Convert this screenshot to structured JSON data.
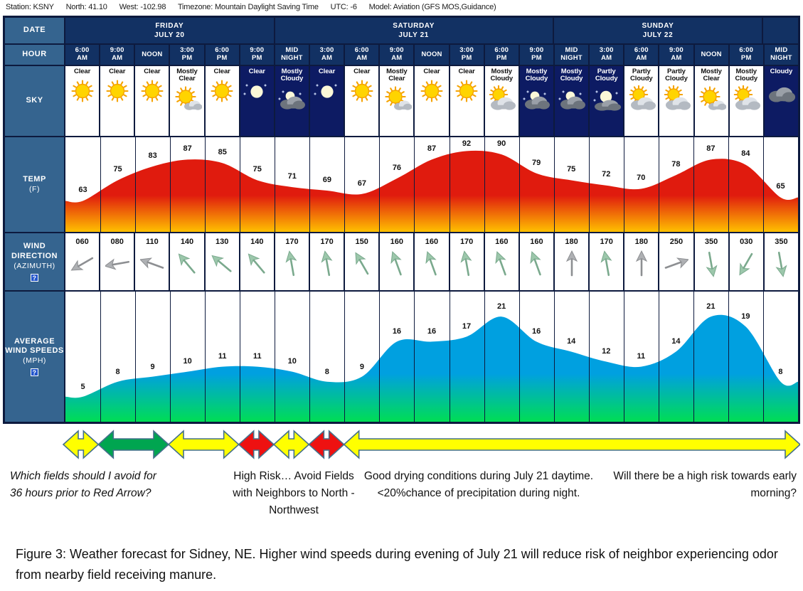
{
  "meta": {
    "station": "Station: KSNY",
    "north": "North: 41.10",
    "west": "West: -102.98",
    "timezone": "Timezone: Mountain Daylight Saving Time",
    "utc": "UTC: -6",
    "model": "Model: Aviation (GFS MOS,Guidance)"
  },
  "labels": {
    "date": "DATE",
    "hour": "HOUR",
    "sky": "SKY",
    "temp": "TEMP",
    "temp_unit": "(F)",
    "wind_direction": "WIND DIRECTION",
    "wind_direction_unit": "(AZIMUTH)",
    "avg_wind": "AVERAGE WIND SPEEDS",
    "avg_wind_unit": "(MPH)",
    "help": "?"
  },
  "colors": {
    "header_navy": "#123163",
    "border_navy": "#0d1a3e",
    "label_blue": "#35648f",
    "night_bg": "#0d1b63",
    "temp_top": "#e01b0e",
    "temp_bottom": "#ffc000",
    "wind_top": "#00a0e0",
    "wind_bottom": "#00dd55",
    "arrow_yellow": "#ffff00",
    "arrow_green": "#00a550",
    "arrow_red": "#ee1111",
    "arrow_outline": "#44708c"
  },
  "dates": [
    {
      "weekday": "FRIDAY",
      "day": "JULY 20",
      "span": 6
    },
    {
      "weekday": "SATURDAY",
      "day": "JULY 21",
      "span": 8
    },
    {
      "weekday": "SUNDAY",
      "day": "JULY 22",
      "span": 6
    },
    {
      "weekday": "",
      "day": "",
      "span": 1
    }
  ],
  "hours": [
    {
      "l1": "6:00",
      "l2": "AM"
    },
    {
      "l1": "9:00",
      "l2": "AM"
    },
    {
      "l1": "NOON",
      "l2": ""
    },
    {
      "l1": "3:00",
      "l2": "PM"
    },
    {
      "l1": "6:00",
      "l2": "PM"
    },
    {
      "l1": "9:00",
      "l2": "PM"
    },
    {
      "l1": "MID",
      "l2": "NIGHT"
    },
    {
      "l1": "3:00",
      "l2": "AM"
    },
    {
      "l1": "6:00",
      "l2": "AM"
    },
    {
      "l1": "9:00",
      "l2": "AM"
    },
    {
      "l1": "NOON",
      "l2": ""
    },
    {
      "l1": "3:00",
      "l2": "PM"
    },
    {
      "l1": "6:00",
      "l2": "PM"
    },
    {
      "l1": "9:00",
      "l2": "PM"
    },
    {
      "l1": "MID",
      "l2": "NIGHT"
    },
    {
      "l1": "3:00",
      "l2": "AM"
    },
    {
      "l1": "6:00",
      "l2": "AM"
    },
    {
      "l1": "9:00",
      "l2": "AM"
    },
    {
      "l1": "NOON",
      "l2": ""
    },
    {
      "l1": "6:00",
      "l2": "PM"
    },
    {
      "l1": "MID",
      "l2": "NIGHT"
    }
  ],
  "sky": [
    {
      "l1": "Clear",
      "l2": "",
      "icon": "sun-icon",
      "night": false
    },
    {
      "l1": "Clear",
      "l2": "",
      "icon": "sun-icon",
      "night": false
    },
    {
      "l1": "Clear",
      "l2": "",
      "icon": "sun-icon",
      "night": false
    },
    {
      "l1": "Mostly",
      "l2": "Clear",
      "icon": "sun-small-cloud-icon",
      "night": false
    },
    {
      "l1": "Clear",
      "l2": "",
      "icon": "sun-icon",
      "night": false
    },
    {
      "l1": "Clear",
      "l2": "",
      "icon": "moon-icon",
      "night": true
    },
    {
      "l1": "Mostly",
      "l2": "Cloudy",
      "icon": "moon-cloud-icon",
      "night": true
    },
    {
      "l1": "Clear",
      "l2": "",
      "icon": "moon-icon",
      "night": true
    },
    {
      "l1": "Clear",
      "l2": "",
      "icon": "sun-icon",
      "night": false
    },
    {
      "l1": "Mostly",
      "l2": "Clear",
      "icon": "sun-small-cloud-icon",
      "night": false
    },
    {
      "l1": "Clear",
      "l2": "",
      "icon": "sun-icon",
      "night": false
    },
    {
      "l1": "Clear",
      "l2": "",
      "icon": "sun-icon",
      "night": false
    },
    {
      "l1": "Mostly",
      "l2": "Cloudy",
      "icon": "sun-big-cloud-icon",
      "night": false
    },
    {
      "l1": "Mostly",
      "l2": "Cloudy",
      "icon": "moon-cloud-icon",
      "night": true
    },
    {
      "l1": "Mostly",
      "l2": "Cloudy",
      "icon": "moon-cloud-icon",
      "night": true
    },
    {
      "l1": "Partly",
      "l2": "Cloudy",
      "icon": "moon-behind-cloud-icon",
      "night": true
    },
    {
      "l1": "Partly",
      "l2": "Cloudy",
      "icon": "sun-big-cloud-icon",
      "night": false
    },
    {
      "l1": "Partly",
      "l2": "Cloudy",
      "icon": "sun-big-cloud-icon",
      "night": false
    },
    {
      "l1": "Mostly",
      "l2": "Clear",
      "icon": "sun-small-cloud-icon",
      "night": false
    },
    {
      "l1": "Mostly",
      "l2": "Cloudy",
      "icon": "sun-big-cloud-icon",
      "night": false
    },
    {
      "l1": "Cloudy",
      "l2": "",
      "icon": "cloud-icon",
      "night": true
    }
  ],
  "chart_data": [
    {
      "type": "area",
      "title": "TEMP (F)",
      "ylabel": "Temperature (F)",
      "categories": [
        "6:00 AM",
        "9:00 AM",
        "NOON",
        "3:00 PM",
        "6:00 PM",
        "9:00 PM",
        "MID NIGHT",
        "3:00 AM",
        "6:00 AM",
        "9:00 AM",
        "NOON",
        "3:00 PM",
        "6:00 PM",
        "9:00 PM",
        "MID NIGHT",
        "3:00 AM",
        "6:00 AM",
        "9:00 AM",
        "NOON",
        "6:00 PM",
        "MID NIGHT"
      ],
      "values": [
        63,
        75,
        83,
        87,
        85,
        75,
        71,
        69,
        67,
        76,
        87,
        92,
        90,
        79,
        75,
        72,
        70,
        78,
        87,
        84,
        65
      ],
      "ylim": [
        45,
        100
      ],
      "grid": true,
      "legend": "none"
    },
    {
      "type": "area",
      "title": "AVERAGE WIND SPEEDS (MPH)",
      "ylabel": "Wind speed (MPH)",
      "categories": [
        "6:00 AM",
        "9:00 AM",
        "NOON",
        "3:00 PM",
        "6:00 PM",
        "9:00 PM",
        "MID NIGHT",
        "3:00 AM",
        "6:00 AM",
        "9:00 AM",
        "NOON",
        "3:00 PM",
        "6:00 PM",
        "9:00 PM",
        "MID NIGHT",
        "3:00 AM",
        "6:00 AM",
        "9:00 AM",
        "NOON",
        "6:00 PM",
        "MID NIGHT"
      ],
      "values": [
        5,
        8,
        9,
        10,
        11,
        11,
        10,
        8,
        9,
        16,
        16,
        17,
        21,
        16,
        14,
        12,
        11,
        14,
        21,
        19,
        8
      ],
      "ylim": [
        0,
        26
      ],
      "grid": true,
      "legend": "none"
    },
    {
      "type": "line",
      "title": "WIND DIRECTION (AZIMUTH)",
      "ylabel": "Azimuth (degrees)",
      "categories": [
        "6:00 AM",
        "9:00 AM",
        "NOON",
        "3:00 PM",
        "6:00 PM",
        "9:00 PM",
        "MID NIGHT",
        "3:00 AM",
        "6:00 AM",
        "9:00 AM",
        "NOON",
        "3:00 PM",
        "6:00 PM",
        "9:00 PM",
        "MID NIGHT",
        "3:00 AM",
        "6:00 AM",
        "9:00 AM",
        "NOON",
        "6:00 PM",
        "MID NIGHT"
      ],
      "values": [
        60,
        80,
        110,
        140,
        130,
        140,
        170,
        170,
        150,
        160,
        160,
        170,
        160,
        160,
        180,
        170,
        180,
        250,
        350,
        30,
        350
      ],
      "ylim": [
        0,
        360
      ],
      "grid": true,
      "legend": "none"
    }
  ],
  "wind_direction": [
    {
      "value": "060",
      "azimuth": 60,
      "gray": true
    },
    {
      "value": "080",
      "azimuth": 80,
      "gray": true
    },
    {
      "value": "110",
      "azimuth": 110,
      "gray": true
    },
    {
      "value": "140",
      "azimuth": 140,
      "gray": false
    },
    {
      "value": "130",
      "azimuth": 130,
      "gray": false
    },
    {
      "value": "140",
      "azimuth": 140,
      "gray": false
    },
    {
      "value": "170",
      "azimuth": 170,
      "gray": false
    },
    {
      "value": "170",
      "azimuth": 170,
      "gray": false
    },
    {
      "value": "150",
      "azimuth": 150,
      "gray": false
    },
    {
      "value": "160",
      "azimuth": 160,
      "gray": false
    },
    {
      "value": "160",
      "azimuth": 160,
      "gray": false
    },
    {
      "value": "170",
      "azimuth": 170,
      "gray": false
    },
    {
      "value": "160",
      "azimuth": 160,
      "gray": false
    },
    {
      "value": "160",
      "azimuth": 160,
      "gray": false
    },
    {
      "value": "180",
      "azimuth": 180,
      "gray": true
    },
    {
      "value": "170",
      "azimuth": 170,
      "gray": false
    },
    {
      "value": "180",
      "azimuth": 180,
      "gray": true
    },
    {
      "value": "250",
      "azimuth": 250,
      "gray": true
    },
    {
      "value": "350",
      "azimuth": 350,
      "gray": false
    },
    {
      "value": "030",
      "azimuth": 30,
      "gray": false
    },
    {
      "value": "350",
      "azimuth": 350,
      "gray": false
    }
  ],
  "annotation_arrows": [
    {
      "name": "arrow-1",
      "color": "#ffff00",
      "start": 0,
      "end": 1,
      "double": true
    },
    {
      "name": "arrow-2",
      "color": "#00a550",
      "start": 1,
      "end": 3,
      "double": true
    },
    {
      "name": "arrow-3",
      "color": "#ffff00",
      "start": 3,
      "end": 5,
      "double": true
    },
    {
      "name": "arrow-4",
      "color": "#ee1111",
      "start": 5,
      "end": 6,
      "double": true
    },
    {
      "name": "arrow-5",
      "color": "#ffff00",
      "start": 6,
      "end": 7,
      "double": true
    },
    {
      "name": "arrow-6",
      "color": "#ee1111",
      "start": 7,
      "end": 8,
      "double": true
    },
    {
      "name": "arrow-7",
      "color": "#ffff00",
      "start": 8,
      "end": 21,
      "double": true
    }
  ],
  "annotations": {
    "a1": "Which fields should I avoid for 36 hours prior to Red Arrow?",
    "a2": "High Risk… Avoid Fields with Neighbors to North - Northwest",
    "a3": "Good drying conditions during July 21 daytime. <20%chance of precipitation during night.",
    "a4": "Will there be a high risk towards early morning?"
  },
  "caption": "Figure 3:  Weather forecast for Sidney, NE. Higher wind speeds during evening of July 21 will reduce risk of neighbor experiencing odor from nearby field receiving manure."
}
